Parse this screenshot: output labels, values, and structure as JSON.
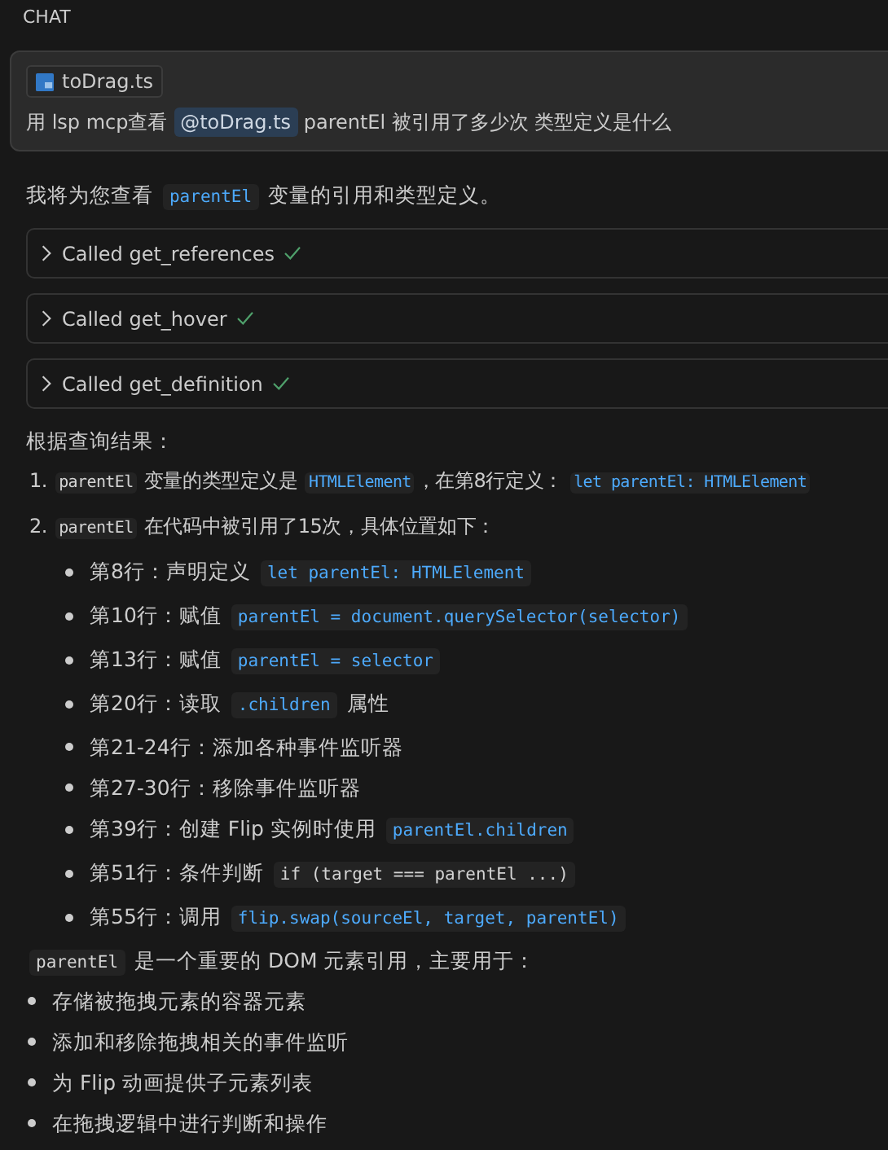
{
  "header": {
    "title": "CHAT"
  },
  "request": {
    "attachment": "toDrag.ts",
    "segments": [
      {
        "kind": "text",
        "text": "用 lsp mcp查看 "
      },
      {
        "kind": "mention",
        "text": "@toDrag.ts"
      },
      {
        "kind": "text",
        "text": " parentEl 被引用了多少次 类型定义是什么"
      }
    ]
  },
  "intro": [
    {
      "kind": "text",
      "text": "我将为您查看 "
    },
    {
      "kind": "symbol",
      "text": "parentEl"
    },
    {
      "kind": "text",
      "text": " 变量的引用和类型定义。"
    }
  ],
  "tool_calls": [
    {
      "label": "Called get_references",
      "expanded": false,
      "done": true
    },
    {
      "label": "Called get_hover",
      "expanded": false,
      "done": true
    },
    {
      "label": "Called get_definition",
      "expanded": false,
      "done": true
    }
  ],
  "result_heading": "根据查询结果：",
  "numbered": [
    {
      "number": "1.",
      "segments": [
        {
          "kind": "code",
          "text": "parentEl"
        },
        {
          "kind": "text",
          "text": " 变量的类型定义是 "
        },
        {
          "kind": "symbol",
          "text": "HTMLElement"
        },
        {
          "kind": "text",
          "text": "，在第8行定义： "
        },
        {
          "kind": "symbol",
          "text": "let parentEl: HTMLElement"
        }
      ]
    },
    {
      "number": "2.",
      "segments": [
        {
          "kind": "code",
          "text": "parentEl"
        },
        {
          "kind": "text",
          "text": " 在代码中被引用了15次，具体位置如下："
        }
      ],
      "children": [
        [
          {
            "kind": "text",
            "text": "第8行：声明定义 "
          },
          {
            "kind": "symbol",
            "text": "let parentEl: HTMLElement"
          }
        ],
        [
          {
            "kind": "text",
            "text": "第10行：赋值 "
          },
          {
            "kind": "symbol",
            "text": "parentEl = document.querySelector(selector)"
          }
        ],
        [
          {
            "kind": "text",
            "text": "第13行：赋值 "
          },
          {
            "kind": "symbol",
            "text": "parentEl = selector"
          }
        ],
        [
          {
            "kind": "text",
            "text": "第20行：读取 "
          },
          {
            "kind": "symbol",
            "text": ".children"
          },
          {
            "kind": "text",
            "text": " 属性"
          }
        ],
        [
          {
            "kind": "text",
            "text": "第21-24行：添加各种事件监听器"
          }
        ],
        [
          {
            "kind": "text",
            "text": "第27-30行：移除事件监听器"
          }
        ],
        [
          {
            "kind": "text",
            "text": "第39行：创建 Flip 实例时使用 "
          },
          {
            "kind": "symbol",
            "text": "parentEl.children"
          }
        ],
        [
          {
            "kind": "text",
            "text": "第51行：条件判断 "
          },
          {
            "kind": "code",
            "text": "if (target === parentEl ...)"
          }
        ],
        [
          {
            "kind": "text",
            "text": "第55行：调用 "
          },
          {
            "kind": "symbol",
            "text": "flip.swap(sourceEl, target, parentEl)"
          }
        ]
      ]
    }
  ],
  "summary": [
    {
      "kind": "code",
      "text": "parentEl"
    },
    {
      "kind": "text",
      "text": " 是一个重要的 DOM 元素引用，主要用于："
    }
  ],
  "uses": [
    "存储被拖拽元素的容器元素",
    "添加和移除拖拽相关的事件监听",
    "为 Flip 动画提供子元素列表",
    "在拖拽逻辑中进行判断和操作"
  ]
}
